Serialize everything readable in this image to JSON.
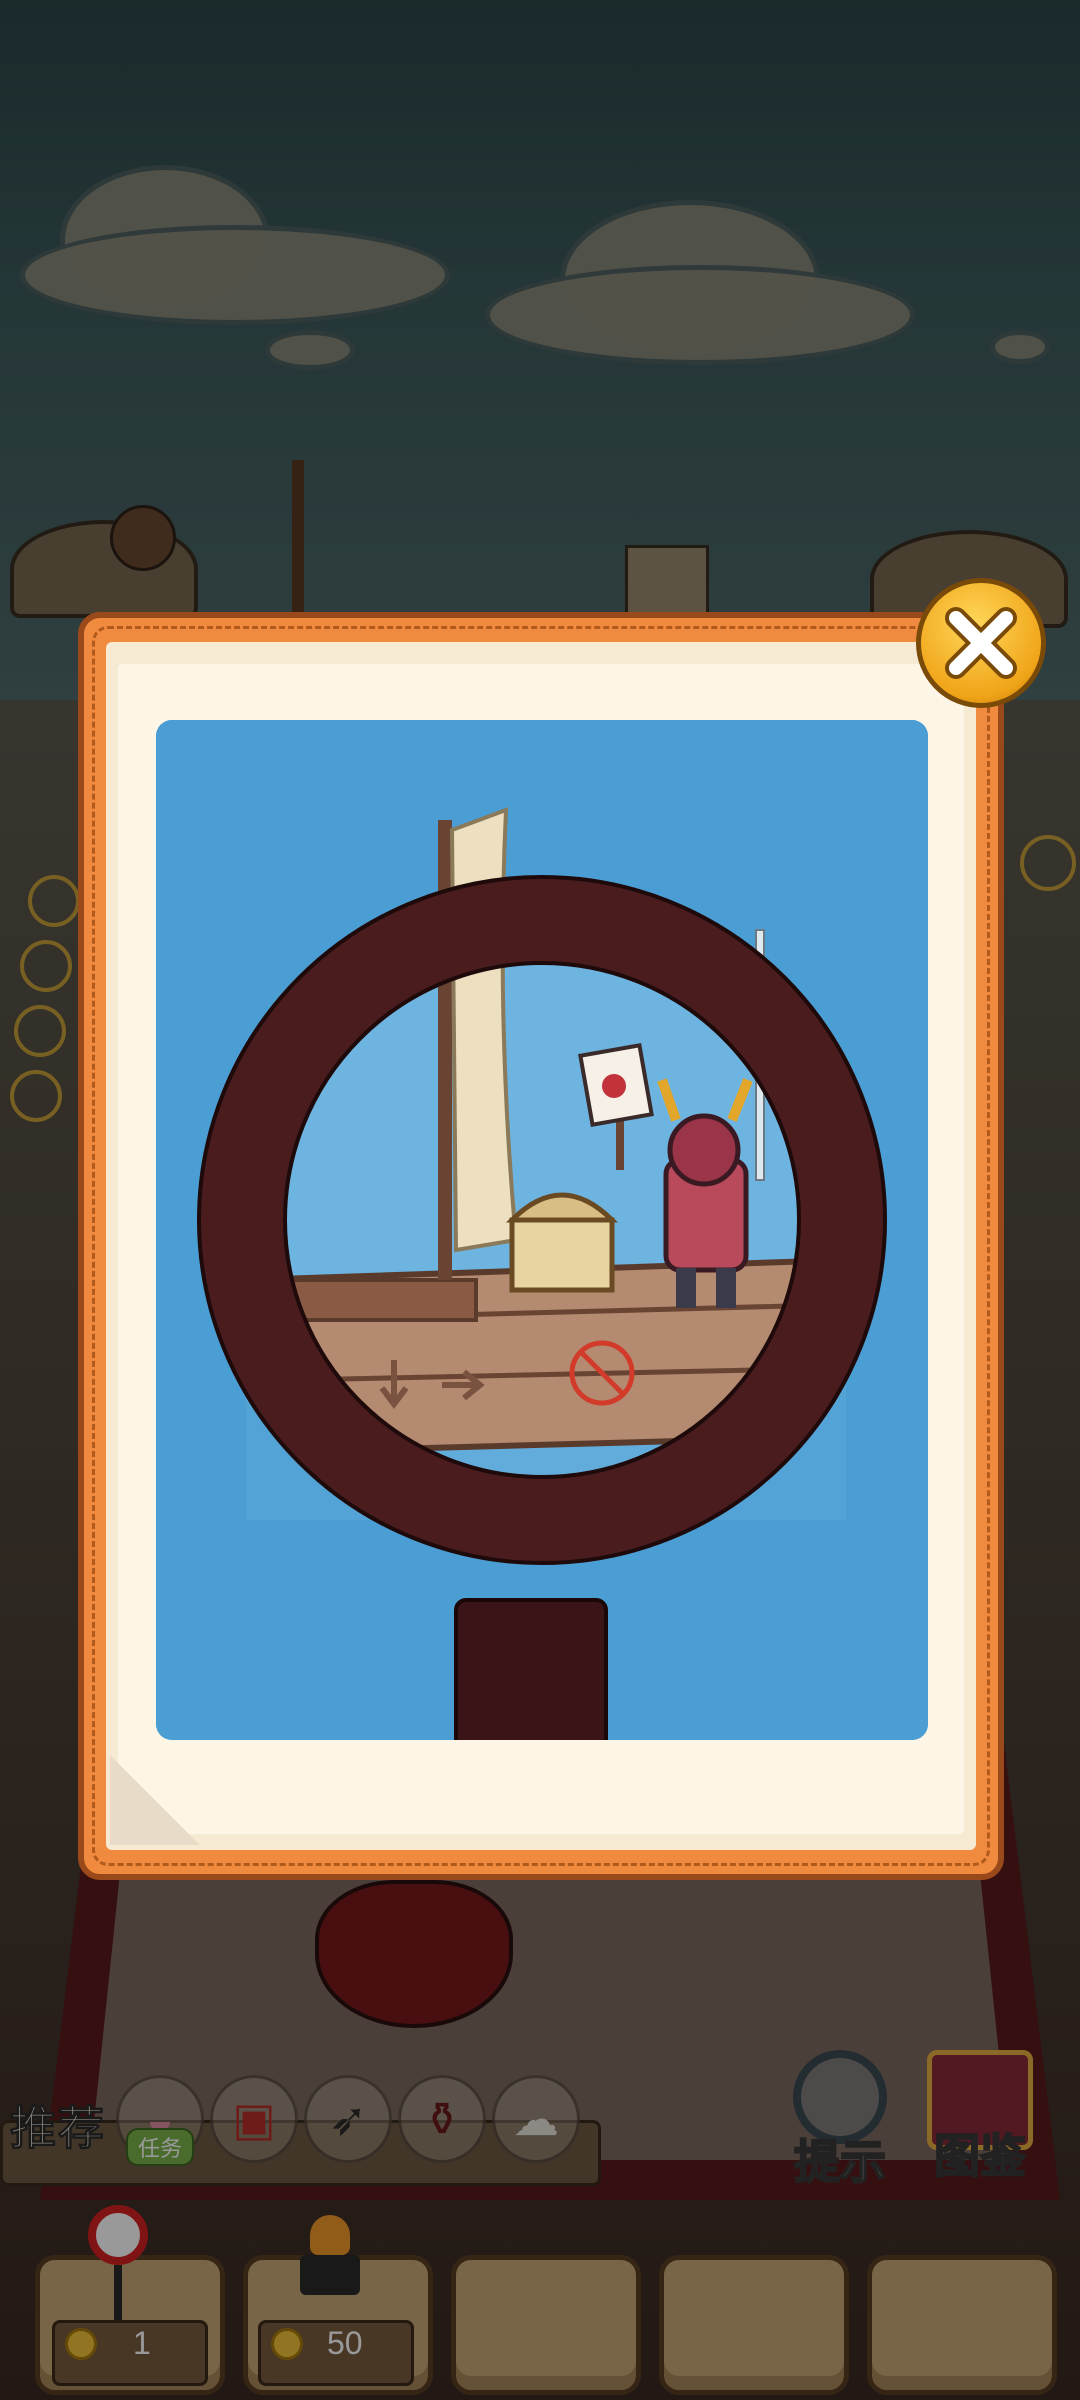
{
  "scene": {
    "recommend_label": "推荐",
    "recommend_items": [
      {
        "icon": "shell-icon",
        "badge": "任务"
      },
      {
        "icon": "treasure-chest-icon"
      },
      {
        "icon": "crossbow-icon"
      },
      {
        "icon": "potion-jar-icon"
      },
      {
        "icon": "sheep-icon"
      }
    ],
    "hint_label": "提示",
    "encyclopedia_label": "图鉴",
    "slots": [
      {
        "item": "no-entry-sign-icon",
        "cost": "1"
      },
      {
        "item": "brazier-icon",
        "cost": "50"
      },
      {
        "item": null
      },
      {
        "item": null
      },
      {
        "item": null
      }
    ]
  },
  "popup": {
    "close_icon": "close-icon",
    "image": "magnifier-boat-samurai-chest"
  },
  "colors": {
    "popup_frame": "#f08a3e",
    "paper": "#f6ead2",
    "sea": "#4b9ed4",
    "close_button": "#f0a418"
  }
}
